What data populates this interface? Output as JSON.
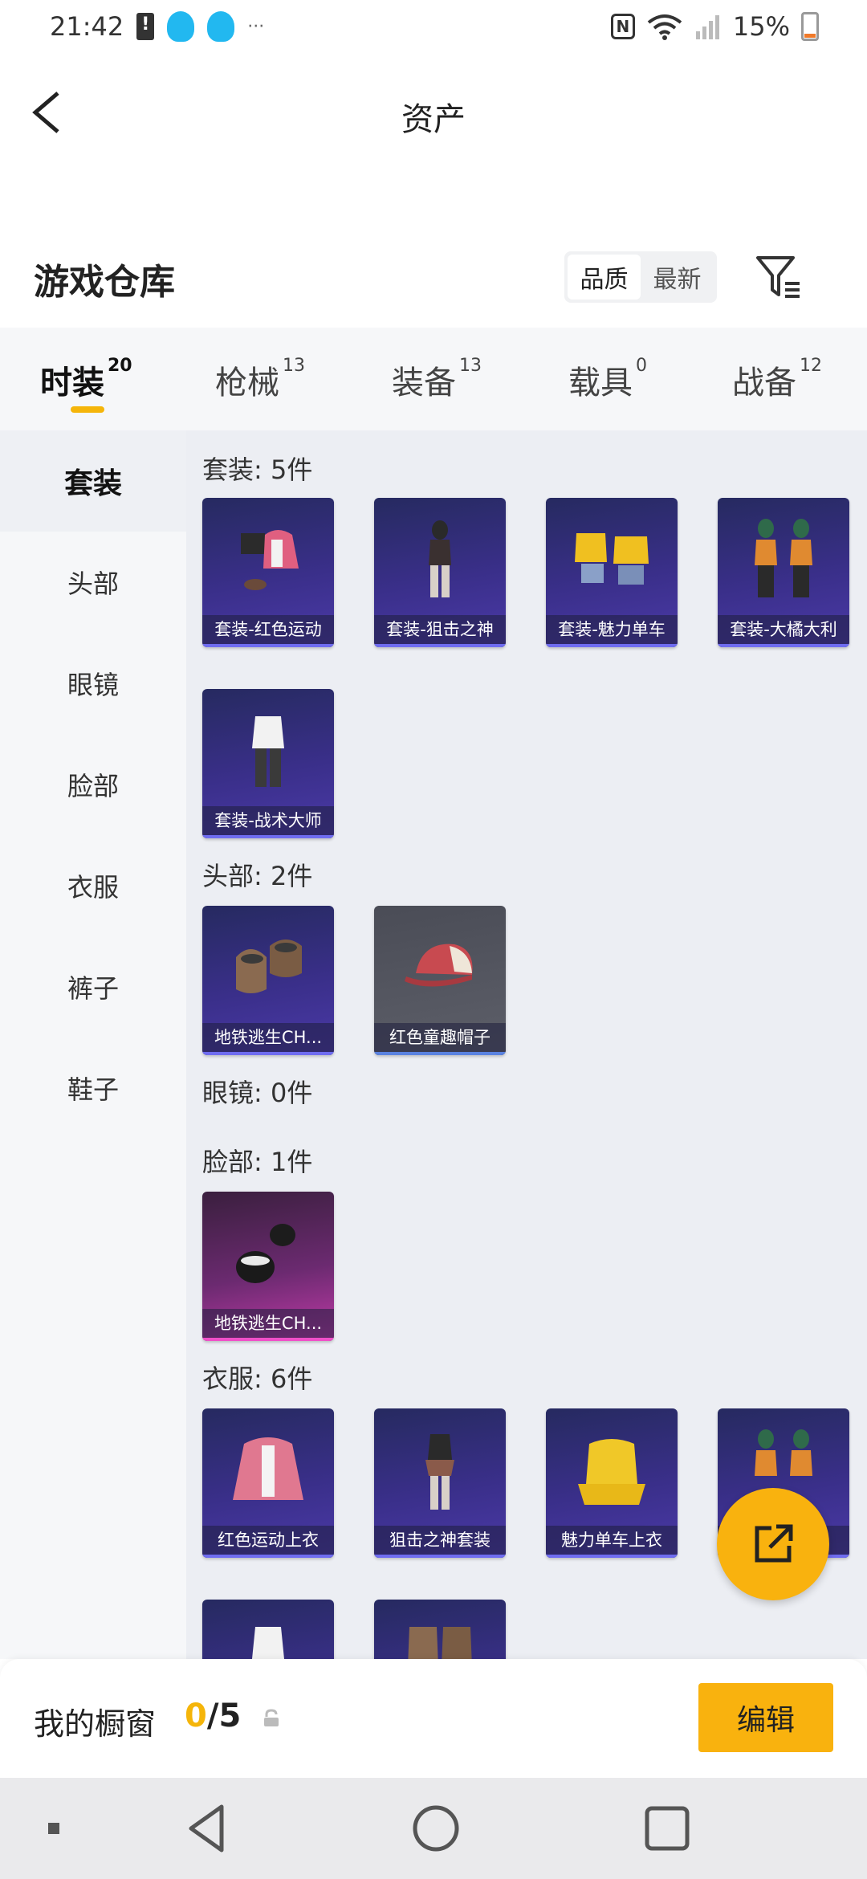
{
  "status_bar": {
    "time": "21:42",
    "dots": "···",
    "battery": "15%"
  },
  "header": {
    "title": "资产"
  },
  "warehouse": {
    "title": "游戏仓库",
    "sort_options": [
      "品质",
      "最新"
    ]
  },
  "tabs": [
    {
      "label": "时装",
      "count": "20"
    },
    {
      "label": "枪械",
      "count": "13"
    },
    {
      "label": "装备",
      "count": "13"
    },
    {
      "label": "载具",
      "count": "0"
    },
    {
      "label": "战备",
      "count": "12"
    }
  ],
  "sidebar": {
    "items": [
      "套装",
      "头部",
      "眼镜",
      "脸部",
      "衣服",
      "裤子",
      "鞋子"
    ]
  },
  "sections": {
    "suits": {
      "label": "套装: 5件",
      "items": [
        "套装-红色运动",
        "套装-狙击之神",
        "套装-魅力单车",
        "套装-大橘大利",
        "套装-战术大师"
      ]
    },
    "head": {
      "label": "头部: 2件",
      "items": [
        "地铁逃生CH...",
        "红色童趣帽子"
      ]
    },
    "glasses": {
      "label": "眼镜: 0件"
    },
    "face": {
      "label": "脸部: 1件",
      "items": [
        "地铁逃生CH..."
      ]
    },
    "clothes": {
      "label": "衣服: 6件",
      "items": [
        "红色运动上衣",
        "狙击之神套装",
        "魅力单车上衣"
      ]
    }
  },
  "showcase": {
    "label": "我的橱窗",
    "used": "0",
    "separator_total": "/5",
    "edit_label": "编辑"
  }
}
